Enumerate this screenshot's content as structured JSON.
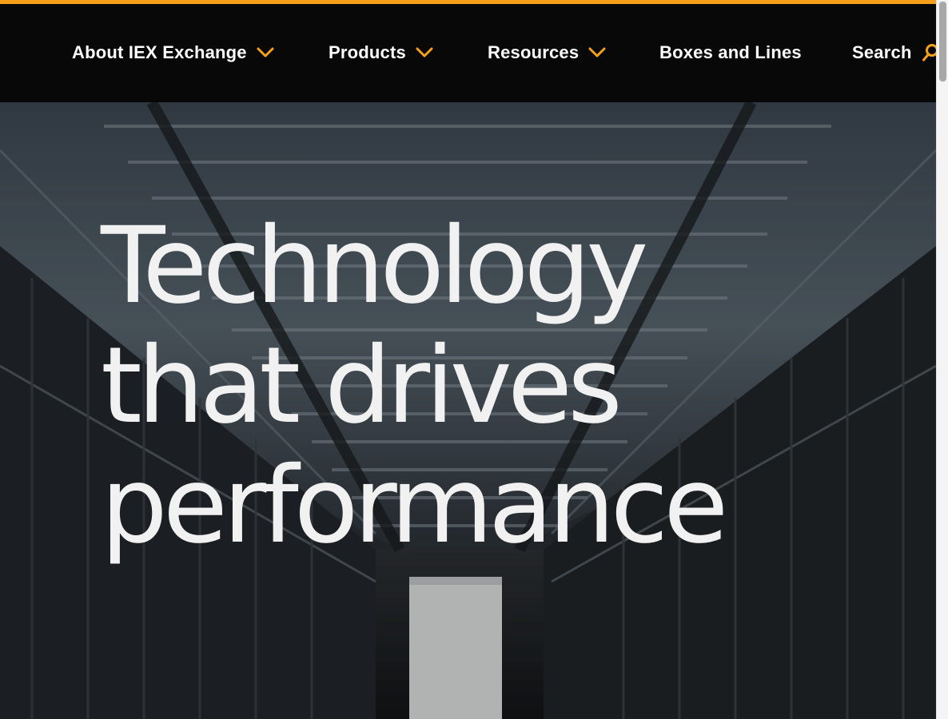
{
  "colors": {
    "accent": "#f7a11a",
    "nav_background": "#080808",
    "nav_text": "#ffffff",
    "hero_text": "#f1f1f1"
  },
  "nav": {
    "items": [
      {
        "label": "About IEX Exchange",
        "has_dropdown": true,
        "icon": "chevron-down-icon"
      },
      {
        "label": "Products",
        "has_dropdown": true,
        "icon": "chevron-down-icon"
      },
      {
        "label": "Resources",
        "has_dropdown": true,
        "icon": "chevron-down-icon"
      },
      {
        "label": "Boxes and Lines",
        "has_dropdown": false
      },
      {
        "label": "Search",
        "icon": "search-icon"
      }
    ]
  },
  "hero": {
    "title_lines": [
      "Technology",
      "that drives",
      "performance"
    ],
    "background": "data-center-aisle-image"
  }
}
